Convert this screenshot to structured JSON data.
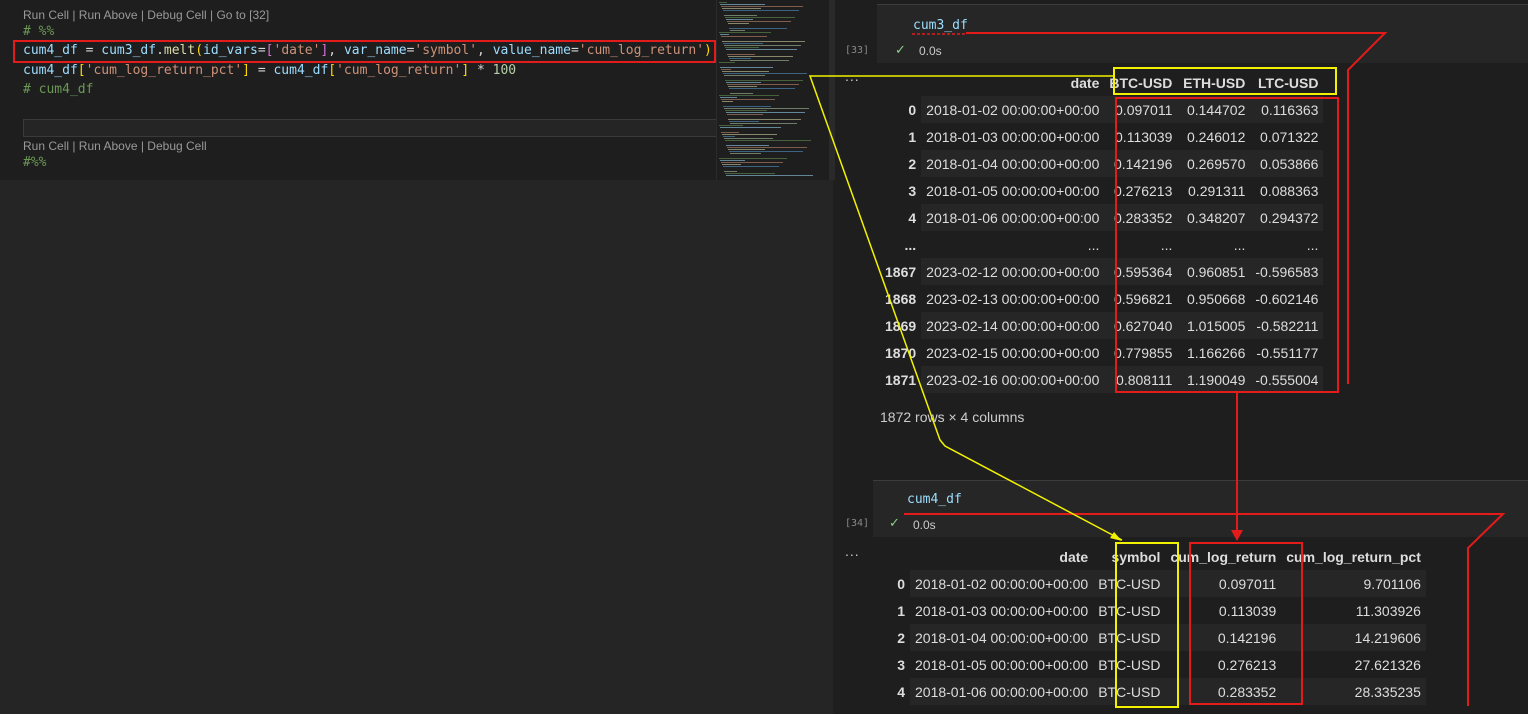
{
  "editor": {
    "codelens1": "Run Cell | Run Above | Debug Cell | Go to [32]",
    "line1": "# %%",
    "line2": {
      "a": "cum4_df",
      "b": " = ",
      "c": "cum3_df",
      "d": ".",
      "e": "melt",
      "f": "(",
      "g": "id_vars",
      "h": "=",
      "i": "[",
      "j": "'date'",
      "k": "]",
      "l": ", ",
      "m": "var_name",
      "n": "=",
      "o": "'symbol'",
      "p": ", ",
      "q": "value_name",
      "r": "=",
      "s": "'cum_log_return'",
      "t": ")"
    },
    "line3": {
      "a": "cum4_df",
      "b": "[",
      "c": "'cum_log_return_pct'",
      "d": "]",
      "e": " = ",
      "f": "cum4_df",
      "g": "[",
      "h": "'cum_log_return'",
      "i": "]",
      "j": " * ",
      "k": "100"
    },
    "line4": "# cum4_df",
    "codelens2": "Run Cell | Run Above | Debug Cell",
    "line5": "#%%"
  },
  "cell33": {
    "number": "[33]",
    "code": "cum3_df",
    "time": "0.0s",
    "more": "...",
    "columns": [
      "",
      "date",
      "BTC-USD",
      "ETH-USD",
      "LTC-USD"
    ],
    "rows": [
      [
        "0",
        "2018-01-02 00:00:00+00:00",
        "0.097011",
        "0.144702",
        "0.116363"
      ],
      [
        "1",
        "2018-01-03 00:00:00+00:00",
        "0.113039",
        "0.246012",
        "0.071322"
      ],
      [
        "2",
        "2018-01-04 00:00:00+00:00",
        "0.142196",
        "0.269570",
        "0.053866"
      ],
      [
        "3",
        "2018-01-05 00:00:00+00:00",
        "0.276213",
        "0.291311",
        "0.088363"
      ],
      [
        "4",
        "2018-01-06 00:00:00+00:00",
        "0.283352",
        "0.348207",
        "0.294372"
      ],
      [
        "...",
        "...",
        "...",
        "...",
        "..."
      ],
      [
        "1867",
        "2023-02-12 00:00:00+00:00",
        "0.595364",
        "0.960851",
        "-0.596583"
      ],
      [
        "1868",
        "2023-02-13 00:00:00+00:00",
        "0.596821",
        "0.950668",
        "-0.602146"
      ],
      [
        "1869",
        "2023-02-14 00:00:00+00:00",
        "0.627040",
        "1.015005",
        "-0.582211"
      ],
      [
        "1870",
        "2023-02-15 00:00:00+00:00",
        "0.779855",
        "1.166266",
        "-0.551177"
      ],
      [
        "1871",
        "2023-02-16 00:00:00+00:00",
        "0.808111",
        "1.190049",
        "-0.555004"
      ]
    ],
    "rowinfo": "1872 rows × 4 columns"
  },
  "cell34": {
    "number": "[34]",
    "code": "cum4_df",
    "time": "0.0s",
    "more": "...",
    "columns": [
      "",
      "date",
      "symbol",
      "cum_log_return",
      "cum_log_return_pct"
    ],
    "rows": [
      [
        "0",
        "2018-01-02 00:00:00+00:00",
        "BTC-USD",
        "0.097011",
        "9.701106"
      ],
      [
        "1",
        "2018-01-03 00:00:00+00:00",
        "BTC-USD",
        "0.113039",
        "11.303926"
      ],
      [
        "2",
        "2018-01-04 00:00:00+00:00",
        "BTC-USD",
        "0.142196",
        "14.219606"
      ],
      [
        "3",
        "2018-01-05 00:00:00+00:00",
        "BTC-USD",
        "0.276213",
        "27.621326"
      ],
      [
        "4",
        "2018-01-06 00:00:00+00:00",
        "BTC-USD",
        "0.283352",
        "28.335235"
      ]
    ]
  },
  "colors": {
    "annotation_red": "#e31b1b",
    "annotation_yellow": "#f2f200",
    "check_green": "#89d185"
  },
  "icons": {
    "check": "check-icon"
  }
}
